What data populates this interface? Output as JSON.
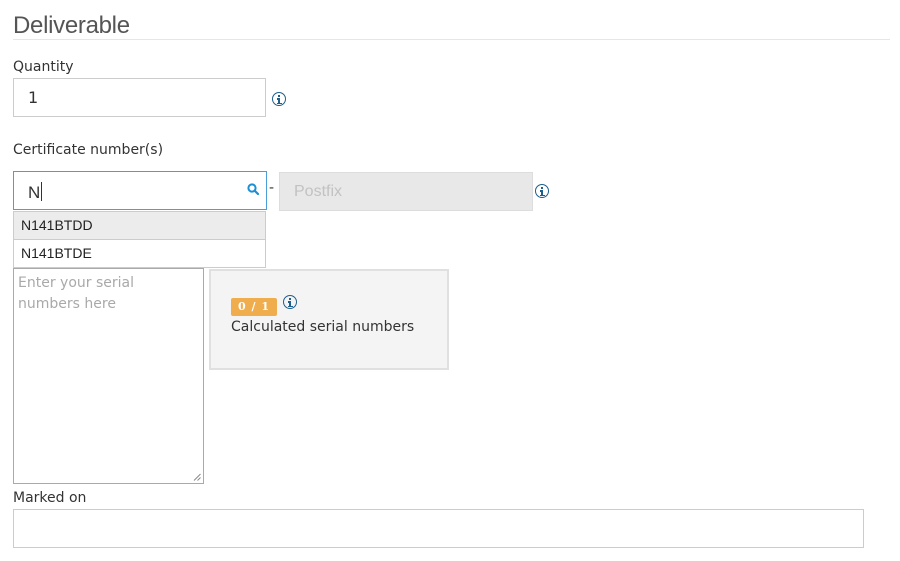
{
  "section": {
    "title": "Deliverable"
  },
  "quantity": {
    "label": "Quantity",
    "value": "1"
  },
  "certificate": {
    "label": "Certificate number(s)",
    "input_value": "N",
    "separator": "-",
    "postfix_placeholder": "Postfix",
    "suggestions": [
      "N141BTDD",
      "N141BTDE"
    ]
  },
  "serials": {
    "placeholder": "Enter your serial numbers here",
    "calculated_count": "0 / 1",
    "calculated_label": "Calculated serial numbers"
  },
  "marked_on": {
    "label": "Marked on",
    "value": ""
  },
  "colors": {
    "focus_border": "#4a9fd8",
    "badge": "#f0ad4e",
    "info_icon": "#1f5f8b"
  }
}
